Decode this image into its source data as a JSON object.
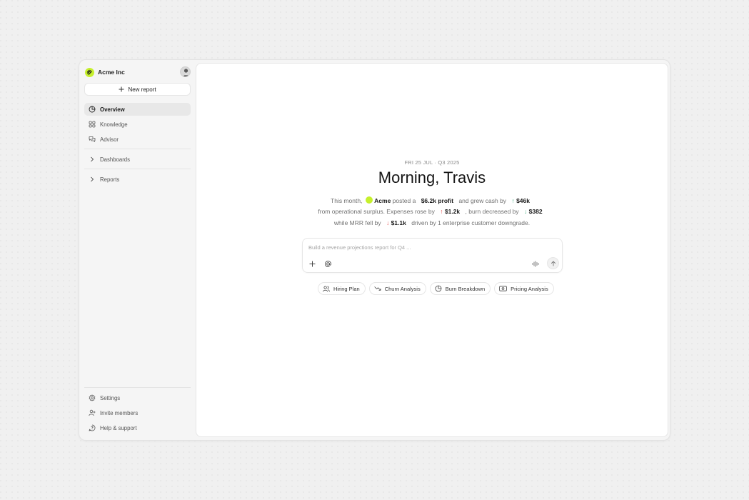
{
  "workspace": {
    "name": "Acme Inc"
  },
  "sidebar": {
    "new_report_label": "New report",
    "primary_items": [
      {
        "label": "Overview",
        "icon": "pie-chart-icon",
        "active": true
      },
      {
        "label": "Knowledge",
        "icon": "grid-icon"
      },
      {
        "label": "Advisor",
        "icon": "chat-icon"
      }
    ],
    "groups": [
      {
        "label": "Dashboards",
        "icon": "chevron-right-icon"
      },
      {
        "label": "Reports",
        "icon": "chevron-right-icon"
      }
    ],
    "footer_items": [
      {
        "label": "Settings",
        "icon": "gear-icon"
      },
      {
        "label": "Invite members",
        "icon": "user-plus-icon"
      },
      {
        "label": "Help & support",
        "icon": "help-icon"
      }
    ]
  },
  "main": {
    "date_line": "FRI 25 JUL · Q3 2025",
    "greeting": "Morning, Travis",
    "summary": {
      "l1_a": "This month,",
      "company": "Acme",
      "l1_b": "posted a",
      "profit": "$6.2k profit",
      "l1_c": "and grew cash by",
      "cash": "$46k",
      "l2_a": "from operational surplus. Expenses rose by",
      "expenses": "$1.2k",
      "l2_b": ", burn decreased by",
      "burn": "$382",
      "l3_a": "while MRR fell by",
      "mrr": "$1.1k",
      "l3_b": "driven by 1 enterprise customer downgrade."
    },
    "prompt": {
      "placeholder": "Build a revenue projections report for Q4 ..."
    },
    "chips": [
      {
        "label": "Hiring Plan",
        "icon": "users-icon"
      },
      {
        "label": "Churn Analysis",
        "icon": "trend-down-icon"
      },
      {
        "label": "Burn Breakdown",
        "icon": "pie-chart-icon"
      },
      {
        "label": "Pricing Analysis",
        "icon": "dollar-card-icon"
      }
    ]
  },
  "colors": {
    "accent": "#c6f02d",
    "up": "#3aa77a",
    "down": "#e24b4b"
  }
}
